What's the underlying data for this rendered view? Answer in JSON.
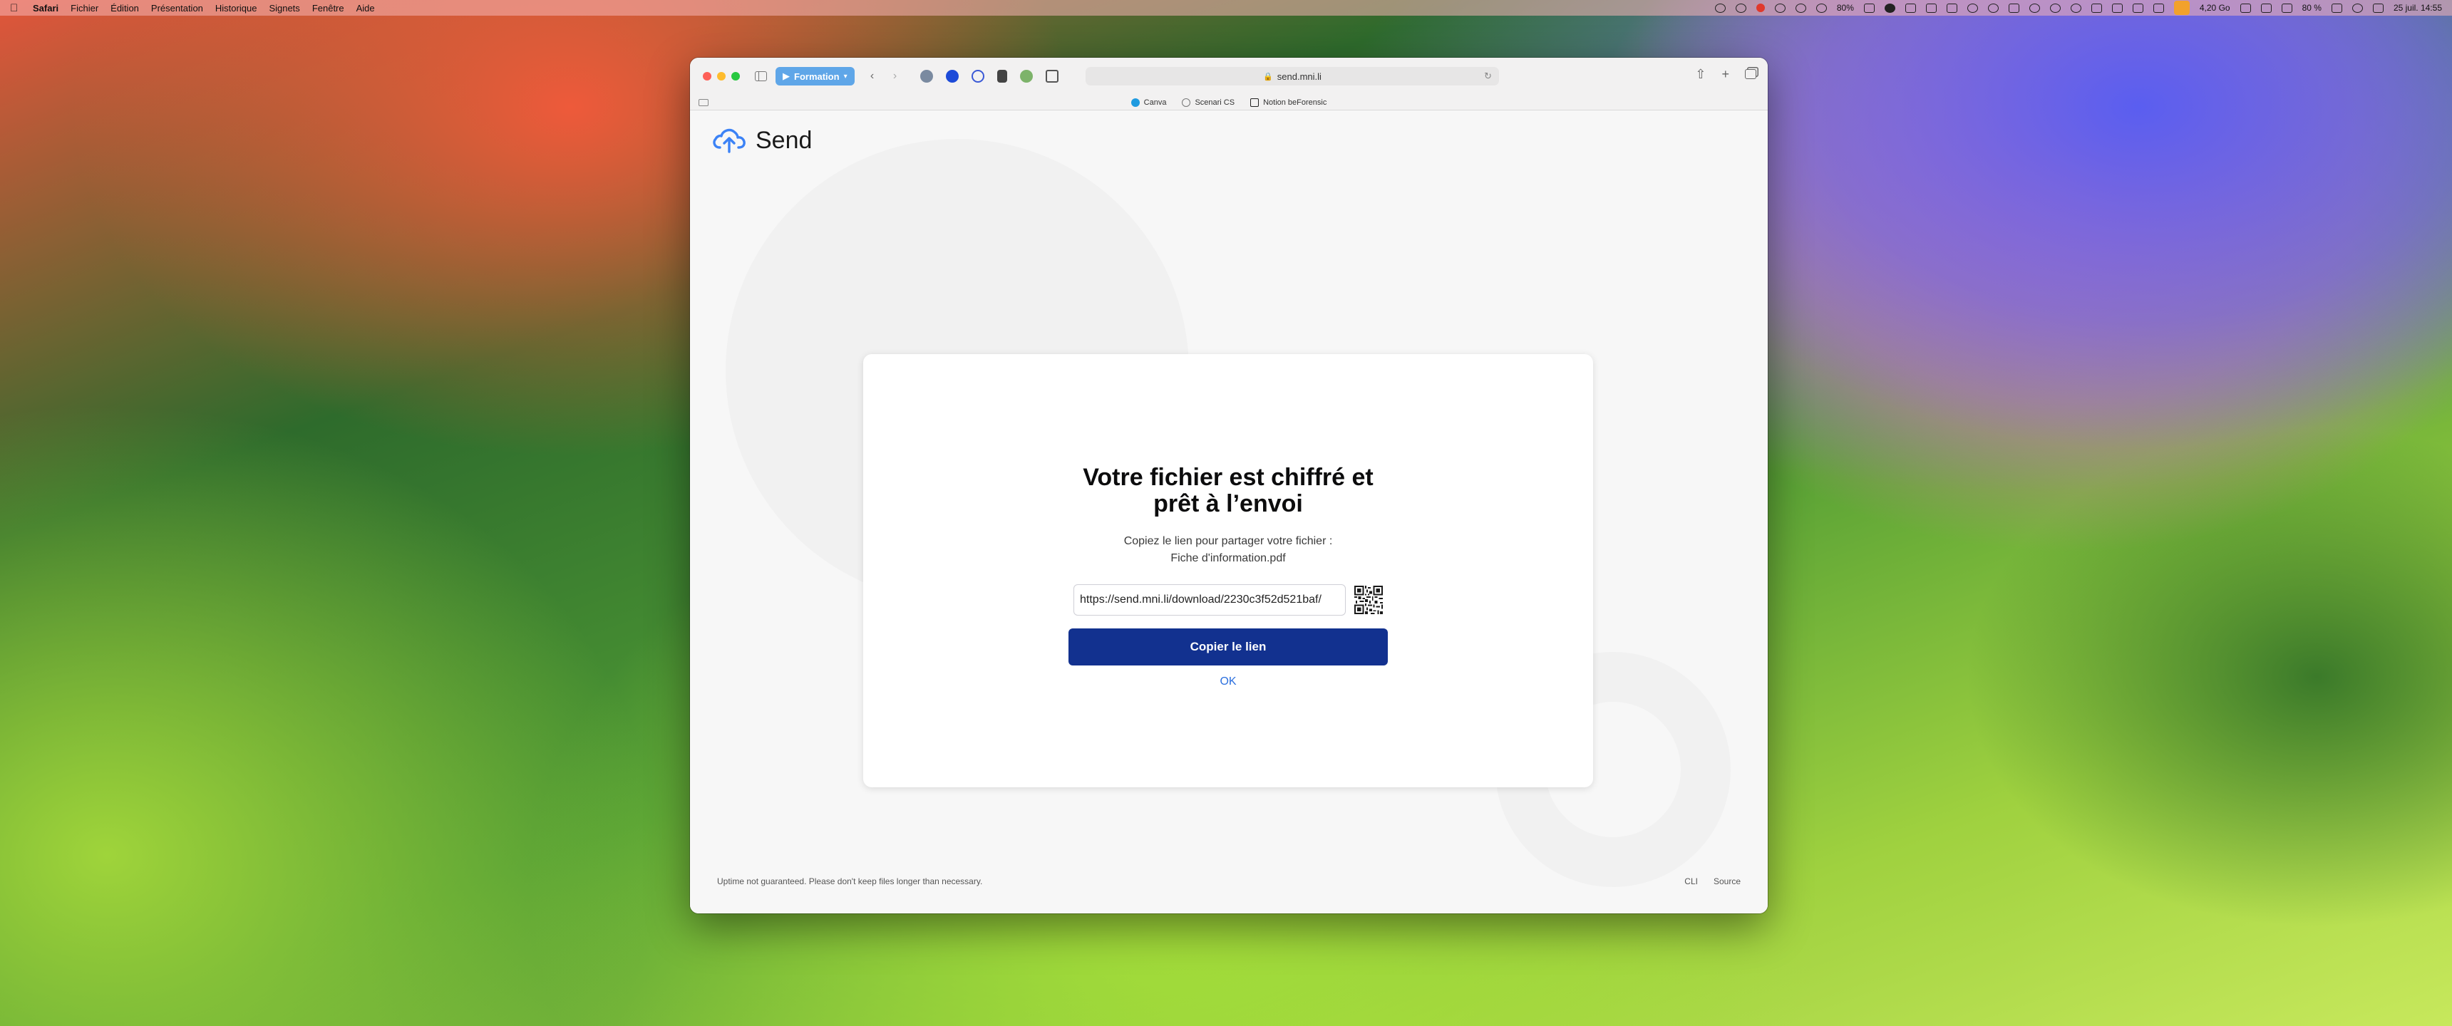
{
  "menubar": {
    "app": "Safari",
    "items": [
      "Fichier",
      "Édition",
      "Présentation",
      "Historique",
      "Signets",
      "Fenêtre",
      "Aide"
    ],
    "status": {
      "cpu": "80%",
      "memory": "4,20 Go",
      "battery": "80 %",
      "datetime": "25 juil. 14:55"
    }
  },
  "browser": {
    "tab_group": "Formation",
    "url": "send.mni.li",
    "favorites": [
      "Canva",
      "Scenari CS",
      "Notion beForensic"
    ]
  },
  "page": {
    "logo_text": "Send",
    "card": {
      "title": "Votre fichier est chiffré et prêt à l’envoi",
      "subtitle": "Copiez le lien pour partager votre fichier :",
      "filename": "Fiche d'information.pdf",
      "link_value": "https://send.mni.li/download/2230c3f52d521baf/",
      "copy_button": "Copier le lien",
      "ok_link": "OK"
    },
    "footer": {
      "disclaimer": "Uptime not guaranteed. Please don't keep files longer than necessary.",
      "links": [
        "CLI",
        "Source"
      ]
    }
  },
  "colors": {
    "primary_button": "#12318f",
    "link": "#2b6fde",
    "tab_group": "#5fa6e8",
    "logo": "#3b82f6"
  },
  "icons": {
    "logo": "cloud-upload-icon",
    "qr": "qr-code-icon"
  }
}
